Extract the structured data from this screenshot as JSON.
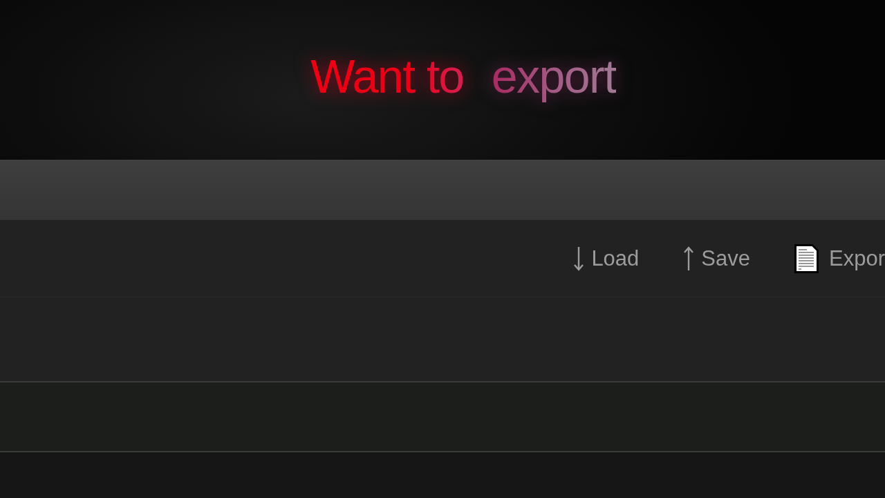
{
  "headline": [
    "Want to",
    "export"
  ],
  "toolbar": {
    "buttons": [
      {
        "kind": "down",
        "label": "Load"
      },
      {
        "kind": "up",
        "label": "Save"
      },
      {
        "kind": "document",
        "label": "Expor"
      }
    ]
  }
}
